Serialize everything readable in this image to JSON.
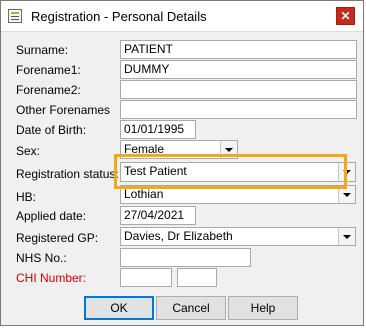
{
  "window": {
    "title": "Registration - Personal Details",
    "close_label": "✕",
    "icon": "app-form-icon"
  },
  "form": {
    "surname": {
      "label": "Surname:",
      "value": "PATIENT"
    },
    "forename1": {
      "label": "Forename1:",
      "value": "DUMMY"
    },
    "forename2": {
      "label": "Forename2:",
      "value": ""
    },
    "other_forenames": {
      "label": "Other Forenames",
      "value": ""
    },
    "dob": {
      "label": "Date of Birth:",
      "value": "01/01/1995"
    },
    "sex": {
      "label": "Sex:",
      "value": "Female"
    },
    "registration_status": {
      "label": "Registration status:",
      "value": "Test Patient"
    },
    "hb": {
      "label": "HB:",
      "value": "Lothian"
    },
    "applied_date": {
      "label": "Applied date:",
      "value": "27/04/2021"
    },
    "registered_gp": {
      "label": "Registered GP:",
      "value": "Davies, Dr Elizabeth"
    },
    "nhs_no": {
      "label": "NHS No.:",
      "value": ""
    },
    "chi_number": {
      "label": "CHI Number:",
      "value1": "",
      "value2": ""
    }
  },
  "buttons": {
    "ok": "OK",
    "cancel": "Cancel",
    "help": "Help"
  },
  "colors": {
    "highlight": "#f3a71b",
    "required_label": "#d40000",
    "close_button": "#c42b1c"
  }
}
